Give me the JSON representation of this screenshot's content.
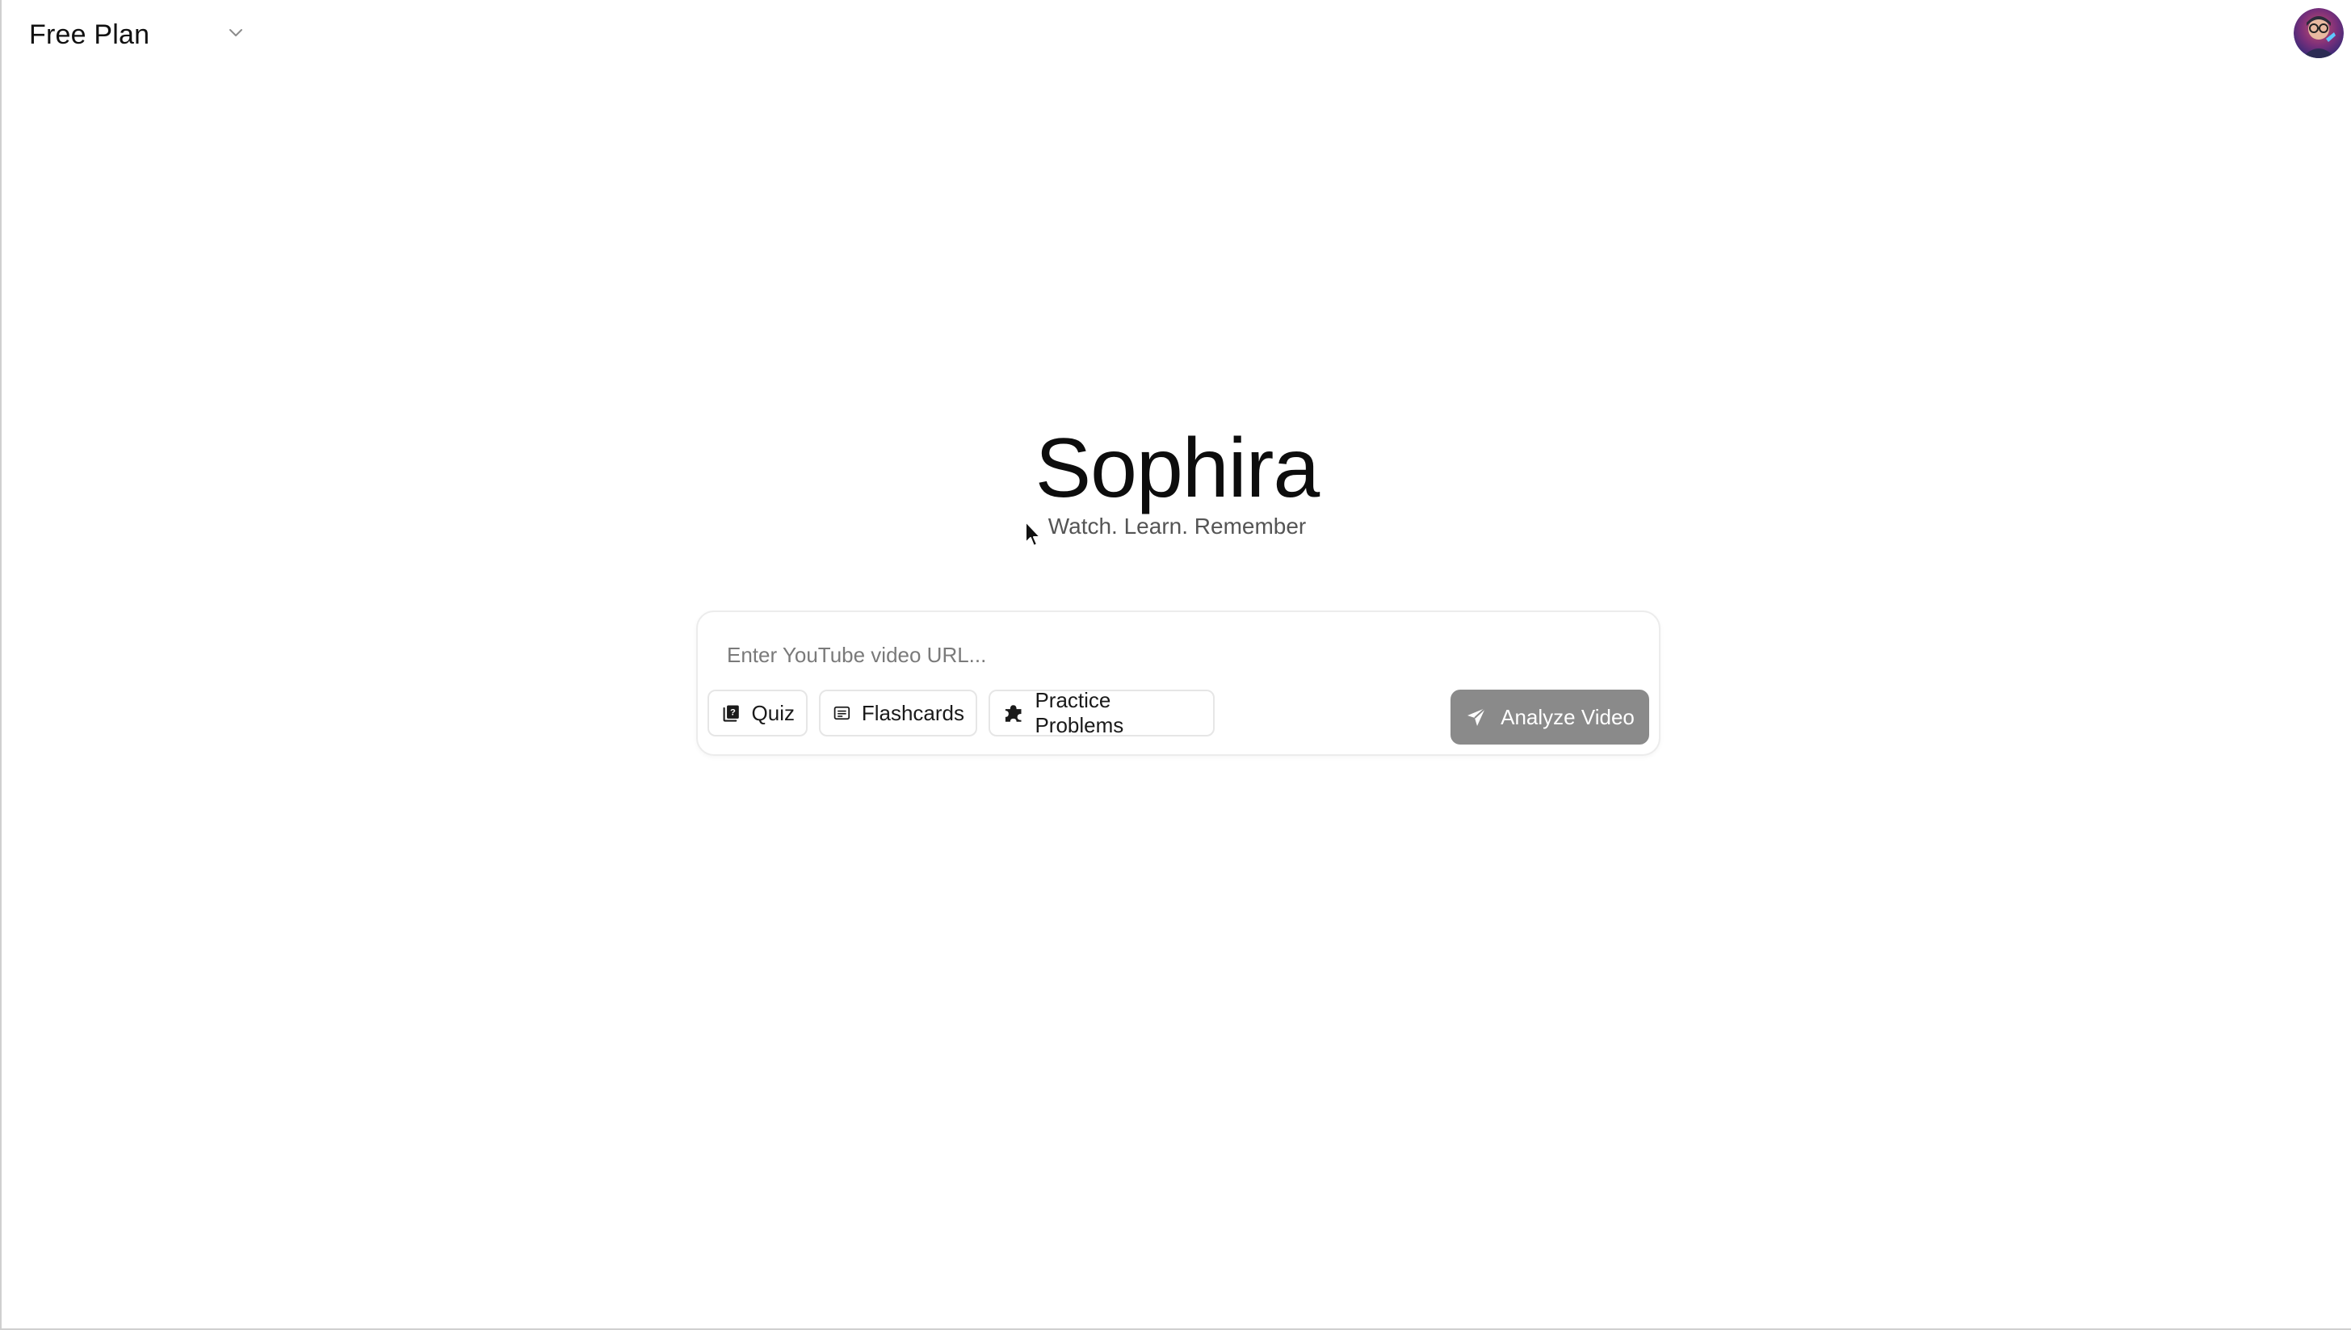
{
  "header": {
    "plan_label": "Free Plan",
    "plan_dropdown_icon": "chevron-down-icon",
    "avatar_icon": "user-avatar"
  },
  "hero": {
    "title": "Sophira",
    "subtitle": "Watch. Learn. Remember"
  },
  "composer": {
    "url_placeholder": "Enter YouTube video URL...",
    "url_value": "",
    "modes": [
      {
        "label": "Quiz",
        "icon": "quiz-icon"
      },
      {
        "label": "Flashcards",
        "icon": "flashcards-icon"
      },
      {
        "label": "Practice Problems",
        "icon": "puzzle-icon"
      }
    ],
    "submit_label": "Analyze Video",
    "submit_icon": "send-icon"
  },
  "colors": {
    "submit_bg": "#8a8a8a",
    "text_primary": "#111111",
    "text_muted": "#555555"
  }
}
